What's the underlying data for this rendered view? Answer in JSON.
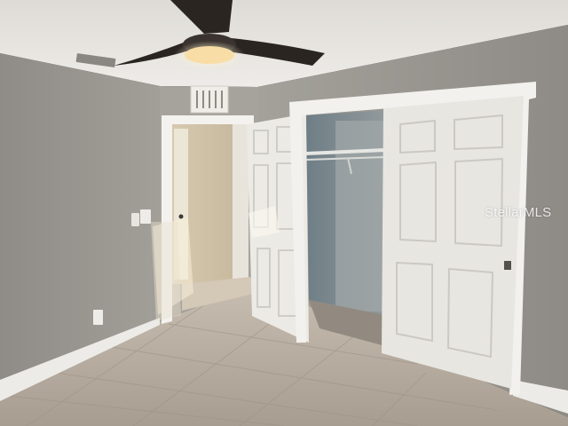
{
  "photo": {
    "watermark_text": "StellarMLS",
    "palette": {
      "ceiling": "#ebe9e5",
      "wall": "#9d9a94",
      "wall_right": "#a29f99",
      "trim": "#f4f3ef",
      "door": "#e9e8e3",
      "closet_interior": "#7e8b92",
      "floor_tile": "#b8ada0",
      "fan_blade": "#2b2522",
      "fan_light": "#f7d79a"
    }
  }
}
